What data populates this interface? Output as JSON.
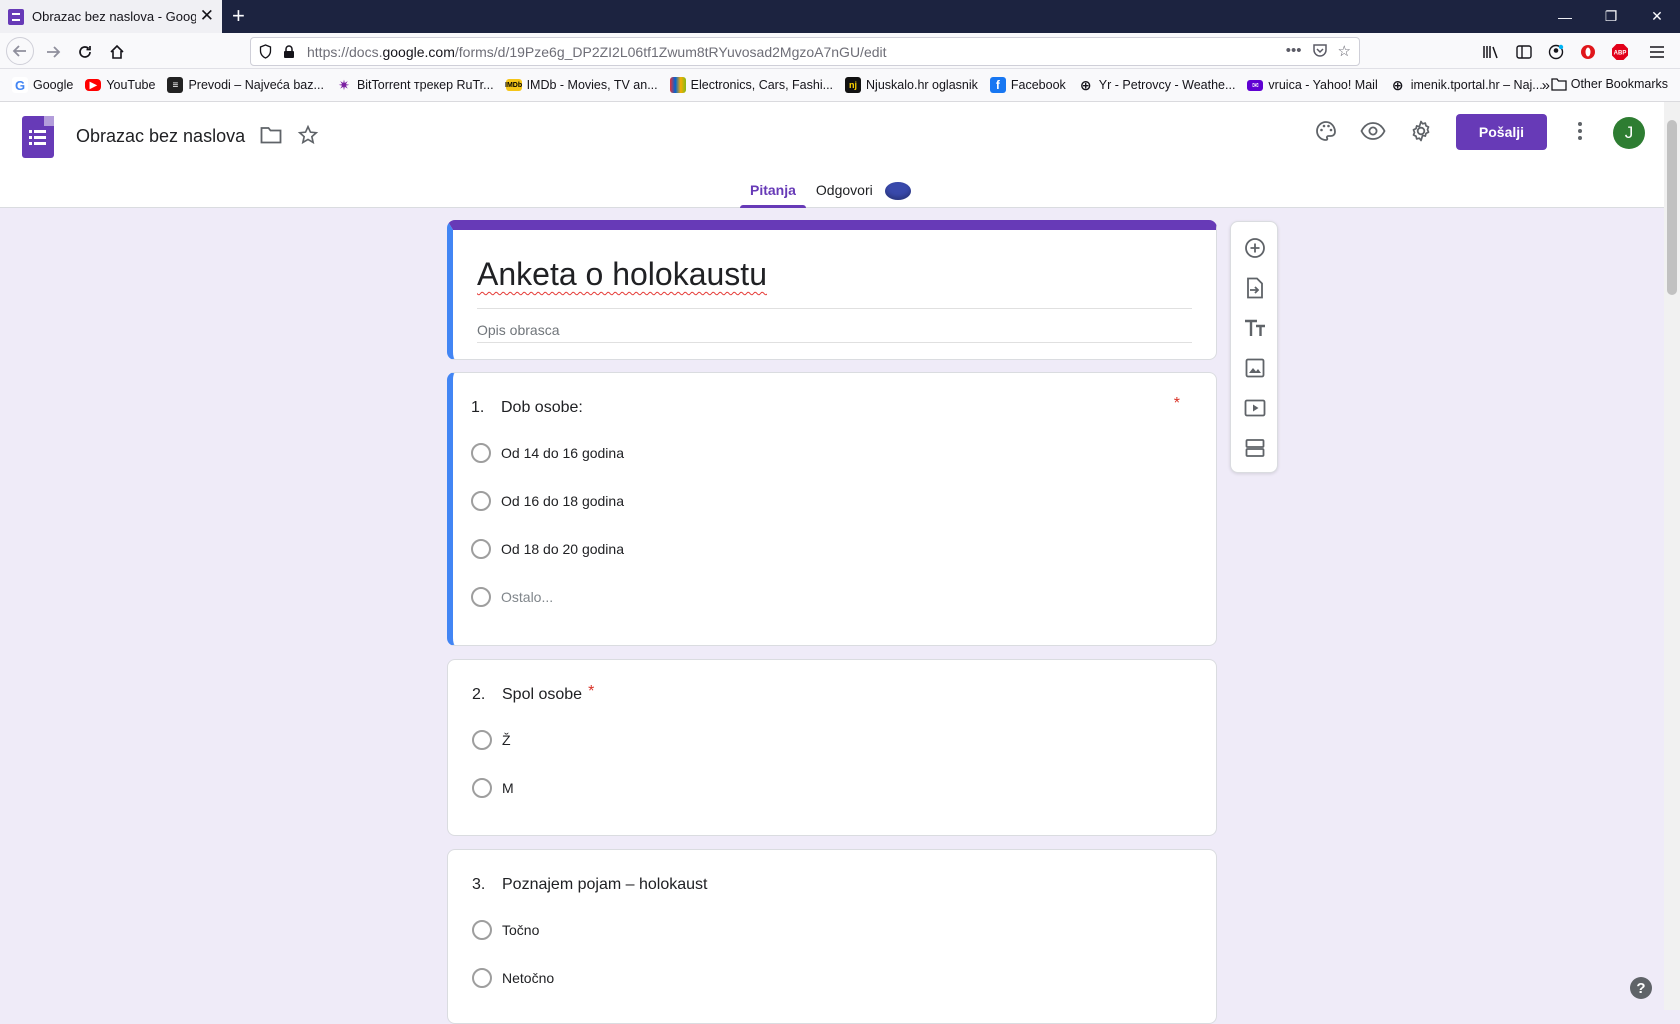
{
  "browser": {
    "tab_title": "Obrazac bez naslova - Google ob",
    "new_tab_symbol": "+",
    "url_prefix": "https://docs.",
    "url_domain": "google.com",
    "url_path": "/forms/d/19Pze6g_DP2ZI2L06tf1Zwum8tRYuvosad2MgzoA7nGU/edit",
    "bookmarks": [
      {
        "label": "Google",
        "icon": "google-icon",
        "color": "#4285f4"
      },
      {
        "label": "YouTube",
        "icon": "youtube-icon",
        "color": "#ff0000"
      },
      {
        "label": "Prevodi – Najveća baz...",
        "icon": "prevodi-icon",
        "color": "#222222"
      },
      {
        "label": "BitTorrent трекер RuTr...",
        "icon": "rutracker-icon",
        "color": "#7b1fa2"
      },
      {
        "label": "IMDb - Movies, TV an...",
        "icon": "imdb-icon",
        "color": "#f5c518"
      },
      {
        "label": "Electronics, Cars, Fashi...",
        "icon": "ebay-icon",
        "color": "#e53238"
      },
      {
        "label": "Njuskalo.hr oglasnik",
        "icon": "njuskalo-icon",
        "color": "#111111"
      },
      {
        "label": "Facebook",
        "icon": "facebook-icon",
        "color": "#1877f2"
      },
      {
        "label": "Yr - Petrovcy - Weathe...",
        "icon": "globe-icon",
        "color": "#5b5b66"
      },
      {
        "label": "vruica - Yahoo! Mail",
        "icon": "yahoo-mail-icon",
        "color": "#6001d2"
      },
      {
        "label": "imenik.tportal.hr – Naj...",
        "icon": "globe-icon",
        "color": "#5b5b66"
      }
    ],
    "other_bookmarks": "Other Bookmarks"
  },
  "forms": {
    "doc_title": "Obrazac bez naslova",
    "send_label": "Pošalji",
    "avatar_initial": "J",
    "tabs": [
      {
        "label": "Pitanja",
        "active": true
      },
      {
        "label": "Odgovori",
        "active": false
      }
    ],
    "accent": "#673ab7"
  },
  "form": {
    "title": "Anketa o holokaustu",
    "description_placeholder": "Opis obrasca",
    "questions": [
      {
        "number": "1.",
        "text": "Dob osobe:",
        "required": "*",
        "options": [
          "Od 14 do 16 godina",
          "Od 16 do 18 godina",
          "Od 18 do 20 godina"
        ],
        "other": "Ostalo..."
      },
      {
        "number": "2.",
        "text": "Spol osobe",
        "required": "*",
        "options": [
          "Ž",
          "M"
        ]
      },
      {
        "number": "3.",
        "text": "Poznajem pojam – holokaust",
        "options": [
          "Točno",
          "Netočno"
        ]
      }
    ]
  },
  "help_symbol": "?"
}
